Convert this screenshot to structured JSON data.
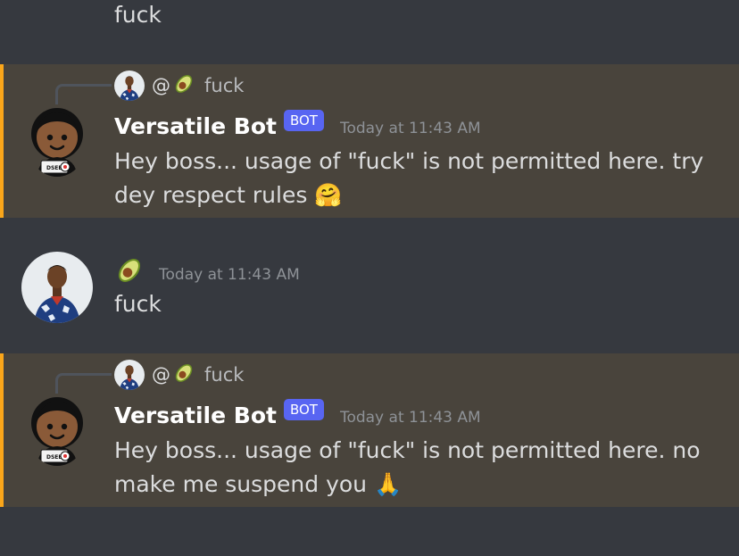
{
  "messages": [
    {
      "type": "continuation",
      "text": "fuck"
    },
    {
      "type": "bot_reply",
      "reply": {
        "at": "@",
        "text": "fuck"
      },
      "author": "Versatile Bot",
      "tag": "BOT",
      "timestamp": "Today at 11:43 AM",
      "text": "Hey boss... usage of \"fuck\" is not permitted here. try dey respect rules 🤗"
    },
    {
      "type": "user",
      "timestamp": "Today at 11:43 AM",
      "text": "fuck"
    },
    {
      "type": "bot_reply",
      "reply": {
        "at": "@",
        "text": "fuck"
      },
      "author": "Versatile Bot",
      "tag": "BOT",
      "timestamp": "Today at 11:43 AM",
      "text": "Hey boss... usage of \"fuck\" is not permitted here. no make me suspend you 🙏"
    }
  ],
  "icons": {
    "user_name_icon": "avocado-icon",
    "bot_avatar": "cartoon-boy-avatar",
    "user_avatar": "user-photo-avatar"
  },
  "colors": {
    "background": "#36393f",
    "mention_bg": "#49443c",
    "mention_bar": "#faa61a",
    "bot_tag": "#5865f2",
    "timestamp": "#8e9297"
  }
}
